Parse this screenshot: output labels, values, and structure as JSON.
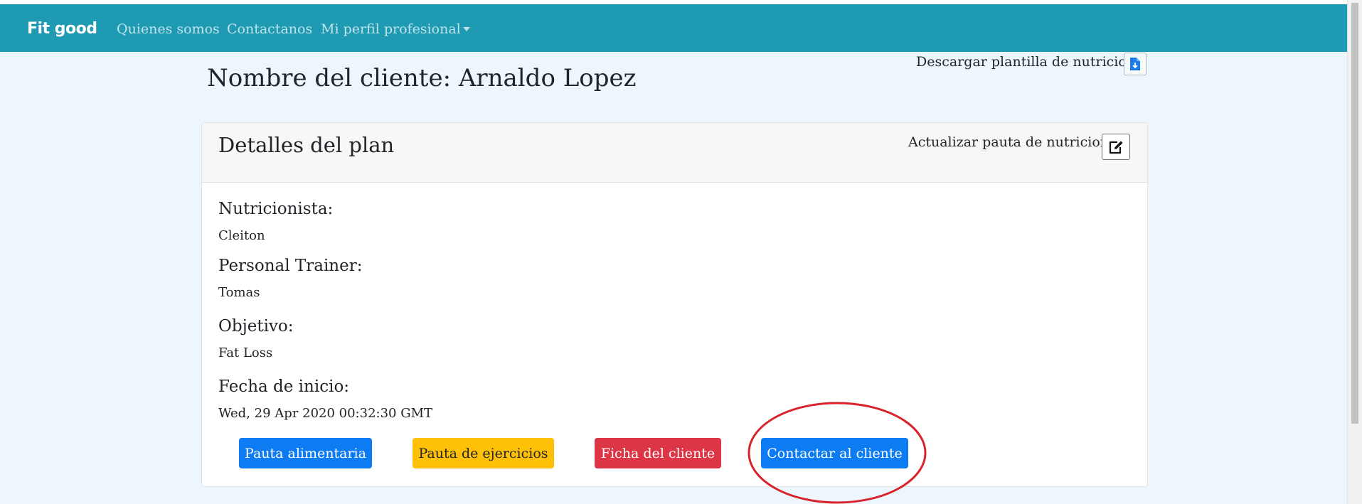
{
  "navbar": {
    "brand": "Fit good",
    "links": [
      "Quienes somos",
      "Contactanos",
      "Mi perfil profesional"
    ],
    "background_color": "#1f9ab3"
  },
  "header": {
    "title": "Nombre del cliente: Arnaldo Lopez",
    "download_label": "Descargar plantilla de nutricion",
    "download_icon": "file-download-icon"
  },
  "card": {
    "title": "Detalles del plan",
    "update_label": "Actualizar pauta de nutricion",
    "update_icon": "edit-icon",
    "fields": [
      {
        "label": "Nutricionista:",
        "value": "Cleiton"
      },
      {
        "label": "Personal Trainer:",
        "value": "Tomas"
      },
      {
        "label": "Objetivo:",
        "value": "Fat Loss"
      },
      {
        "label": "Fecha de inicio:",
        "value": "Wed, 29 Apr 2020 00:32:30 GMT"
      }
    ],
    "buttons": [
      {
        "label": "Pauta alimentaria",
        "color": "#0d7bf2"
      },
      {
        "label": "Pauta de ejercicios",
        "color": "#ffc107"
      },
      {
        "label": "Ficha del cliente",
        "color": "#dc3545"
      },
      {
        "label": "Contactar al cliente",
        "color": "#0d7bf2"
      }
    ]
  },
  "annotation": {
    "shape": "ellipse",
    "color": "#d9232c",
    "target": "Contactar al cliente"
  }
}
